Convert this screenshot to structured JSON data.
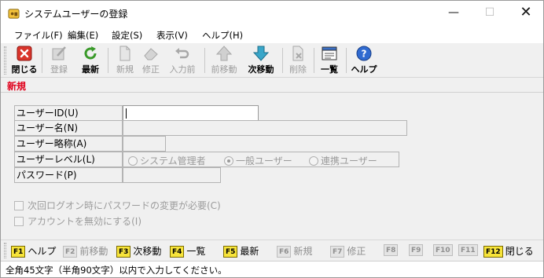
{
  "window": {
    "title": "システムユーザーの登録",
    "min_glyph": "—",
    "max_glyph": "☐",
    "close_glyph": "✕"
  },
  "menu": [
    "ファイル(F)",
    "編集(E)",
    "設定(S)",
    "表示(V)",
    "ヘルプ(H)"
  ],
  "toolbar": {
    "close": "閉じる",
    "register": "登録",
    "refresh": "最新",
    "new": "新規",
    "fix": "修正",
    "input_prev": "入力前",
    "prev_move": "前移動",
    "next_move": "次移動",
    "delete": "削除",
    "list": "一覧",
    "help": "ヘルプ"
  },
  "mode": "新規",
  "form": {
    "user_id_label": "ユーザーID(U)",
    "user_id_value": "",
    "user_name_label": "ユーザー名(N)",
    "user_short_label": "ユーザー略称(A)",
    "user_level_label": "ユーザーレベル(L)",
    "level_options": [
      "システム管理者",
      "一般ユーザー",
      "連携ユーザー"
    ],
    "level_selected": "一般ユーザー",
    "password_label": "パスワード(P)",
    "check_password_change": "次回ログオン時にパスワードの変更が必要(C)",
    "check_disable_account": "アカウントを無効にする(I)"
  },
  "fkeys": [
    {
      "key": "F1",
      "label": "ヘルプ",
      "enabled": true
    },
    {
      "key": "F2",
      "label": "前移動",
      "enabled": false
    },
    {
      "key": "F3",
      "label": "次移動",
      "enabled": true
    },
    {
      "key": "F4",
      "label": "一覧",
      "enabled": true
    },
    {
      "key": "F5",
      "label": "最新",
      "enabled": true
    },
    {
      "key": "F6",
      "label": "新規",
      "enabled": false
    },
    {
      "key": "F7",
      "label": "修正",
      "enabled": false
    },
    {
      "key": "F8",
      "label": "",
      "enabled": false
    },
    {
      "key": "F9",
      "label": "",
      "enabled": false
    },
    {
      "key": "F10",
      "label": "",
      "enabled": false
    },
    {
      "key": "F11",
      "label": "",
      "enabled": false
    },
    {
      "key": "F12",
      "label": "閉じる",
      "enabled": true
    }
  ],
  "status": "全角45文字（半角90文字）以内で入力してください。",
  "colors": {
    "mode_red": "#e0001b",
    "fkey_yellow": "#f7e43a",
    "close_red": "#d9342b",
    "refresh_green": "#3a9a2a",
    "arrow_teal": "#39a6c9",
    "help_blue": "#2f6ad0"
  }
}
